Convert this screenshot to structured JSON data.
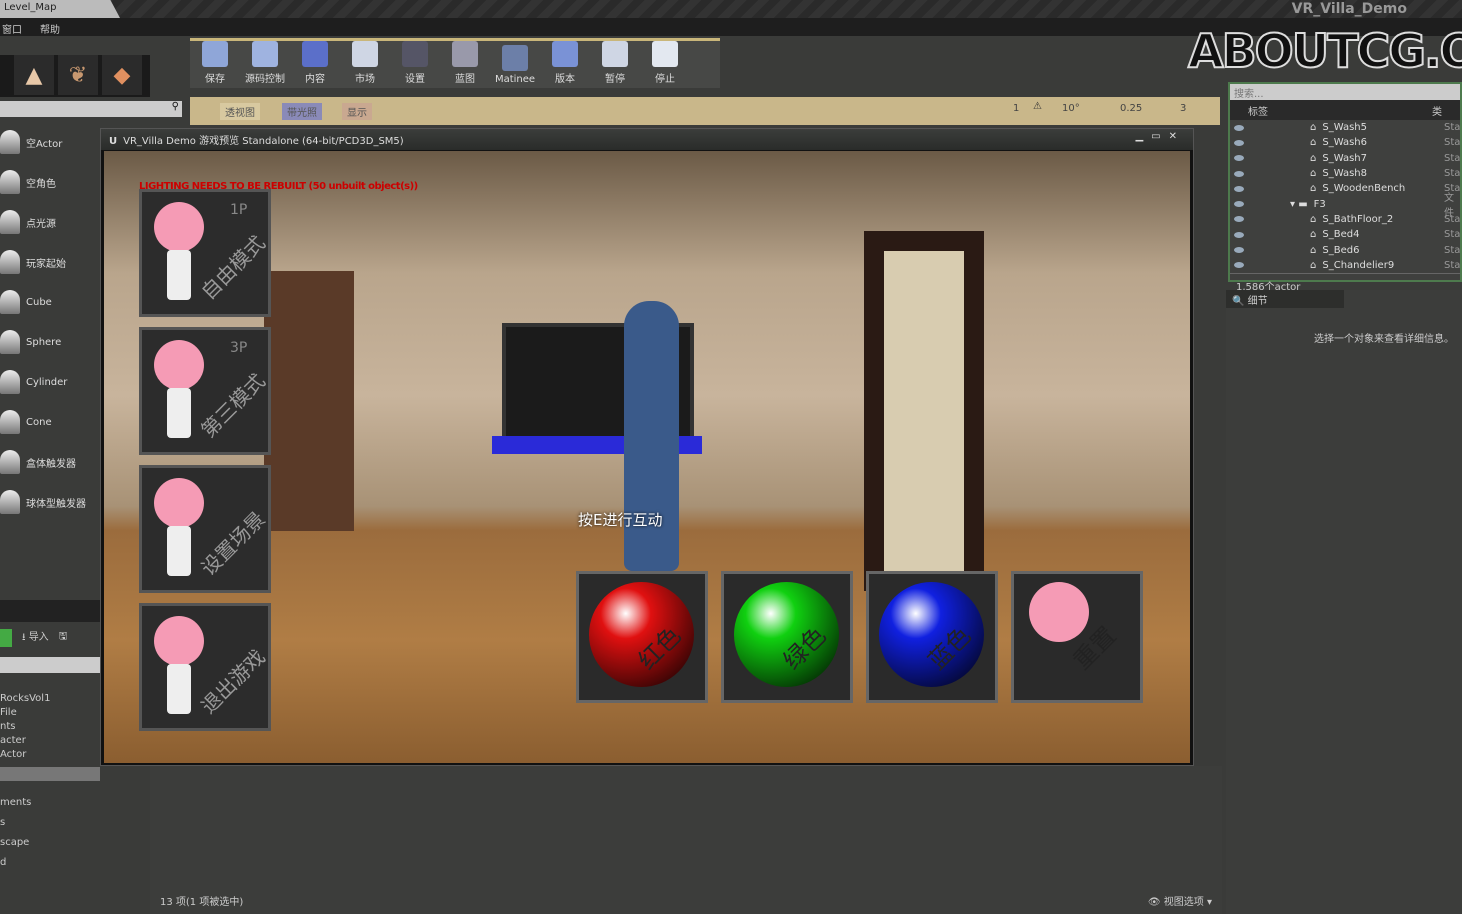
{
  "window": {
    "level_tab": "Level_Map",
    "app_title": "VR_Villa_Demo"
  },
  "menu": [
    "窗口",
    "帮助"
  ],
  "toolbar": [
    {
      "label": "保存",
      "color": "#8fa6d8"
    },
    {
      "label": "源码控制",
      "color": "#9fb3e0"
    },
    {
      "label": "内容",
      "color": "#5b6fc9"
    },
    {
      "label": "市场",
      "color": "#cfd6e4"
    },
    {
      "label": "设置",
      "color": "#556"
    },
    {
      "label": "蓝图",
      "color": "#99a"
    },
    {
      "label": "Matinee",
      "color": "#6c7fa8"
    },
    {
      "label": "版本",
      "color": "#7a92d6"
    },
    {
      "label": "暂停",
      "color": "#cfd6e4"
    },
    {
      "label": "停止",
      "color": "#e3e8f0"
    }
  ],
  "viewport_toolbar": {
    "perspective": "透视图",
    "lit": "带光照",
    "show": "显示",
    "rotation_snap": "10°",
    "scale_snap": "0.25",
    "camera_speed": "3",
    "grid_size": "1"
  },
  "place_items": [
    "空Actor",
    "空角色",
    "点光源",
    "玩家起始",
    "Cube",
    "Sphere",
    "Cylinder",
    "Cone",
    "盒体触发器",
    "球体型触发器"
  ],
  "content_browser": {
    "import": "导入",
    "items": [
      "RocksVol1",
      "File",
      "nts",
      "acter",
      "Actor"
    ],
    "items2": [
      "ments",
      "s",
      "scape",
      "d"
    ],
    "status": "13 项(1 项被选中)",
    "view_options": "视图选项"
  },
  "game_window": {
    "title": "VR_Villa Demo 游戏预览 Standalone (64-bit/PCD3D_SM5)",
    "lighting_warning": "LIGHTING NEEDS TO BE REBUILT (50 unbuilt object(s))",
    "prompt": "按E进行互动",
    "mode_cards": [
      {
        "tag": "1P",
        "label": "自由模式"
      },
      {
        "tag": "3P",
        "label": "第三模式"
      },
      {
        "tag": "",
        "label": "设置场景"
      },
      {
        "tag": "",
        "label": "退出游戏"
      }
    ],
    "color_buttons": [
      {
        "label": "红色",
        "color": "#e01010"
      },
      {
        "label": "绿色",
        "color": "#10d010"
      },
      {
        "label": "蓝色",
        "color": "#1020e0"
      },
      {
        "label": "重置",
        "color": ""
      }
    ]
  },
  "outliner": {
    "search": "搜索...",
    "column_label": "标签",
    "column_type": "类",
    "rows": [
      {
        "name": "S_Wash5",
        "type": "Sta",
        "folder": false
      },
      {
        "name": "S_Wash6",
        "type": "Sta",
        "folder": false
      },
      {
        "name": "S_Wash7",
        "type": "Sta",
        "folder": false
      },
      {
        "name": "S_Wash8",
        "type": "Sta",
        "folder": false
      },
      {
        "name": "S_WoodenBench",
        "type": "Sta",
        "folder": false
      },
      {
        "name": "F3",
        "type": "文件",
        "folder": true
      },
      {
        "name": "S_BathFloor_2",
        "type": "Sta",
        "folder": false
      },
      {
        "name": "S_Bed4",
        "type": "Sta",
        "folder": false
      },
      {
        "name": "S_Bed6",
        "type": "Sta",
        "folder": false
      },
      {
        "name": "S_Chandelier9",
        "type": "Sta",
        "folder": false
      }
    ],
    "count": "1,586个actor"
  },
  "details": {
    "tab": "细节",
    "empty": "选择一个对象来查看详细信息。"
  },
  "watermark": "ABOUTCG.ORG"
}
